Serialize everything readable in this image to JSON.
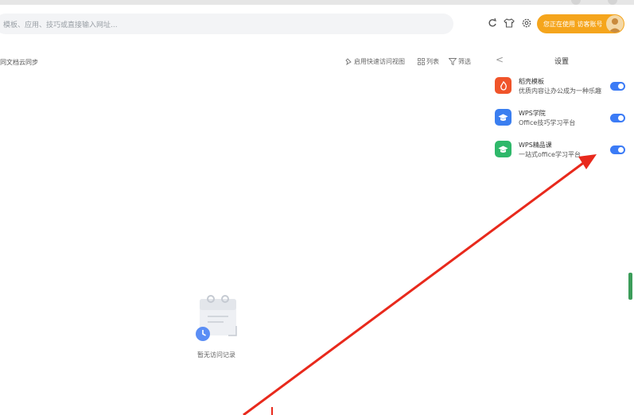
{
  "search": {
    "placeholder": "模板、应用、技巧或直接输入网址..."
  },
  "account_badge": {
    "label": "您正在使用 访客账号"
  },
  "sync_text": "同文档云同步",
  "toolbar": {
    "quick_view": "启用快速访问视图",
    "list": "列表",
    "filter": "筛选"
  },
  "panel": {
    "back_glyph": "<",
    "title": "设置",
    "apps": [
      {
        "name": "稻壳模板",
        "desc": "优质内容让办公成为一种乐趣",
        "enabled": true,
        "color": "#f0542a",
        "icon": "daoke-icon"
      },
      {
        "name": "WPS学院",
        "desc": "Office技巧学习平台",
        "enabled": true,
        "color": "#3a7ef0",
        "icon": "graduation-cap-icon"
      },
      {
        "name": "WPS精品课",
        "desc": "一站式office学习平台",
        "enabled": true,
        "color": "#2fb86a",
        "icon": "course-icon"
      }
    ]
  },
  "empty": {
    "text": "暂无访问记录"
  },
  "colors": {
    "accent": "#3b7bf6",
    "badge": "#f5a51c",
    "annotation": "#e8291c"
  }
}
